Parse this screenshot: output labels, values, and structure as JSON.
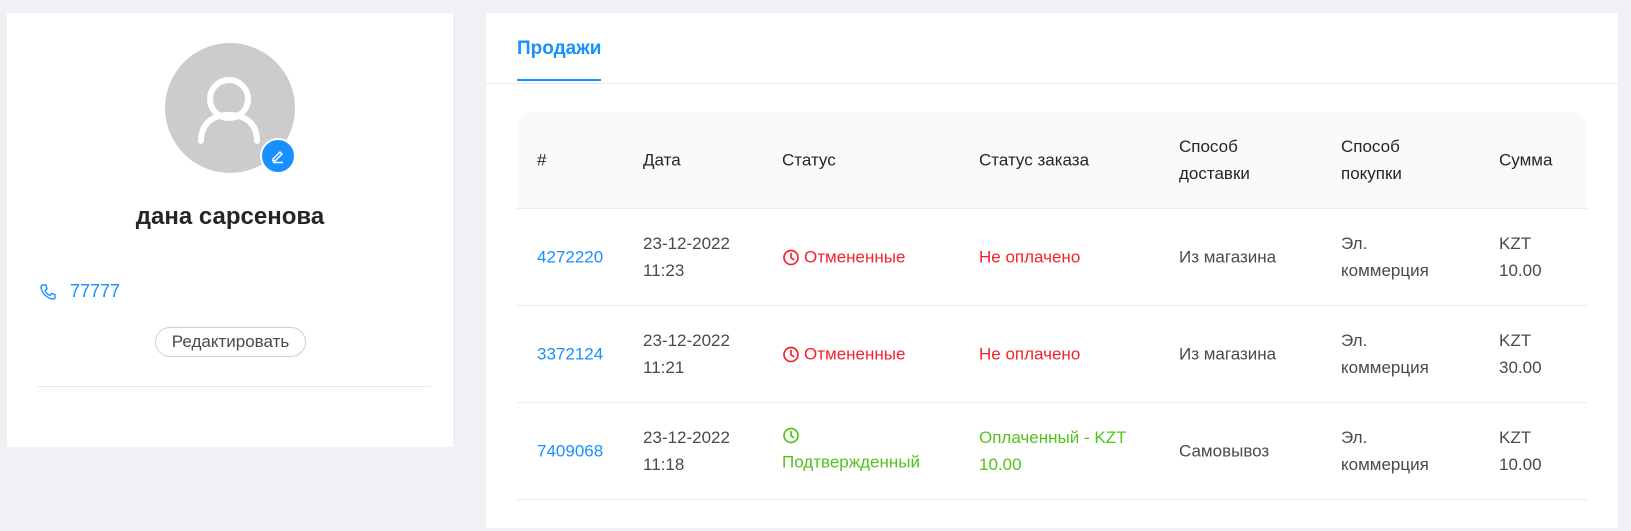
{
  "profile": {
    "name": "дана сарсенова",
    "phone": "77777",
    "edit_label": "Редактировать"
  },
  "tabs": [
    {
      "label": "Продажи"
    }
  ],
  "table": {
    "headers": [
      "#",
      "Дата",
      "Статус",
      "Статус заказа",
      "Способ доставки",
      "Способ покупки",
      "Сумма"
    ],
    "rows": [
      {
        "id": "4272220",
        "date": "23-12-2022 11:23",
        "status": "Отмененные",
        "order_status": "Не оплачено",
        "delivery": "Из магазина",
        "purchase": "Эл. коммерция",
        "amount": "KZT 10.00"
      },
      {
        "id": "3372124",
        "date": "23-12-2022 11:21",
        "status": "Отмененные",
        "order_status": "Не оплачено",
        "delivery": "Из магазина",
        "purchase": "Эл. коммерция",
        "amount": "KZT 30.00"
      },
      {
        "id": "7409068",
        "date": "23-12-2022 11:18",
        "status": "Подтвержденный",
        "order_status": "Оплаченный - KZT 10.00",
        "delivery": "Самовывоз",
        "purchase": "Эл. коммерция",
        "amount": "KZT 10.00"
      }
    ]
  },
  "icons": {
    "avatar": "user-icon",
    "avatar_edit": "pencil-icon",
    "phone": "phone-icon",
    "status": "clock-icon"
  },
  "colors": {
    "accent": "#1890ff",
    "cancelled": "#f5222d",
    "confirmed": "#52c41a",
    "background": "#eff1f4"
  }
}
